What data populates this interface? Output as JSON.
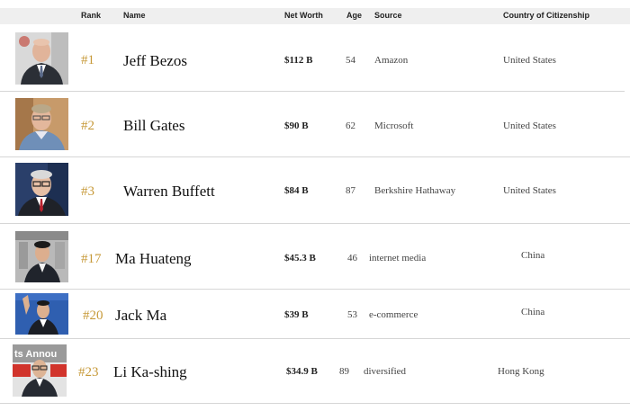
{
  "columns": {
    "rank": "Rank",
    "name": "Name",
    "net_worth": "Net Worth",
    "age": "Age",
    "source": "Source",
    "country": "Country of Citizenship"
  },
  "rows": [
    {
      "rank": "#1",
      "name": "Jeff Bezos",
      "net_worth": "$112 B",
      "age": "54",
      "source": "Amazon",
      "country": "United States"
    },
    {
      "rank": "#2",
      "name": "Bill Gates",
      "net_worth": "$90 B",
      "age": "62",
      "source": "Microsoft",
      "country": "United States"
    },
    {
      "rank": "#3",
      "name": "Warren Buffett",
      "net_worth": "$84 B",
      "age": "87",
      "source": "Berkshire Hathaway",
      "country": "United States"
    },
    {
      "rank": "#17",
      "name": "Ma Huateng",
      "net_worth": "$45.3 B",
      "age": "46",
      "source": "internet media",
      "country": "China"
    },
    {
      "rank": "#20",
      "name": "Jack Ma",
      "net_worth": "$39 B",
      "age": "53",
      "source": "e-commerce",
      "country": "China"
    },
    {
      "rank": "#23",
      "name": "Li Ka-shing",
      "net_worth": "$34.9 B",
      "age": "89",
      "source": "diversified",
      "country": "Hong Kong"
    }
  ],
  "photo_overlay_text": "ts Annou",
  "colors": {
    "rank_gold": "#c79a3a",
    "header_bg": "#efefef",
    "divider": "#d6d6d6"
  }
}
